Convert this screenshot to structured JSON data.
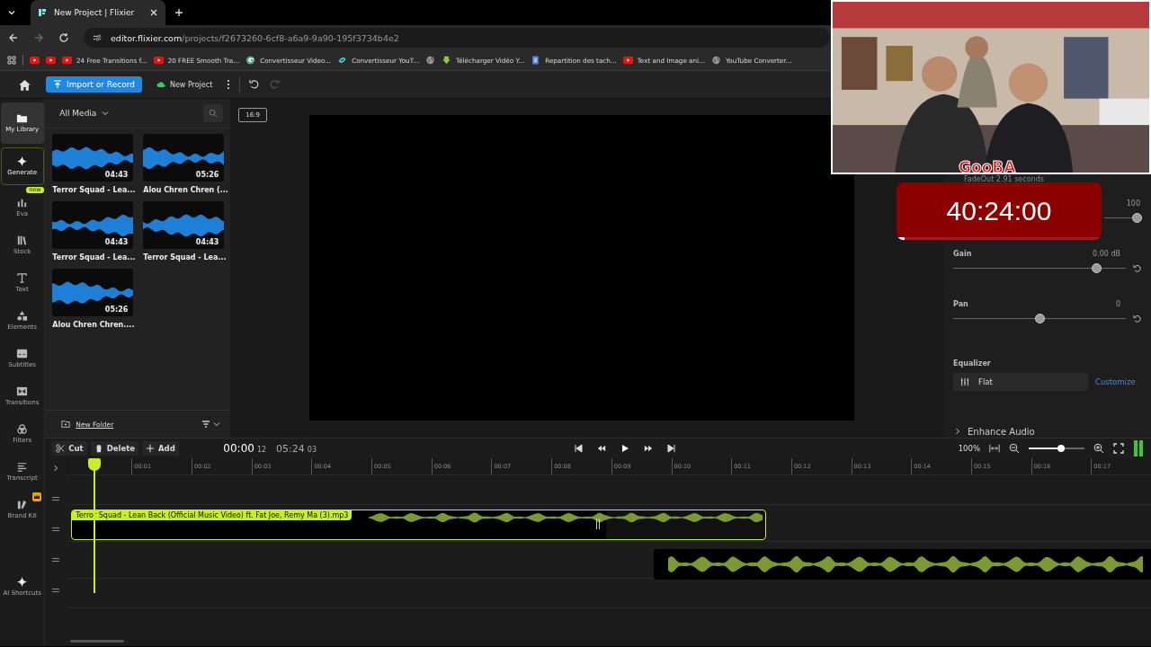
{
  "browser": {
    "tab_title": "New Project | Flixier",
    "url_host": "editor.flixier.com",
    "url_path": "/projects/f2673260-6cf8-a6a9-9a90-195f3734b4e2",
    "bookmarks": [
      {
        "kind": "youtube"
      },
      {
        "kind": "youtube"
      },
      {
        "kind": "youtube",
        "label": "24 Free Transitions f..."
      },
      {
        "kind": "youtube",
        "label": "20 FREE Smooth Tra..."
      },
      {
        "kind": "google",
        "label": "Convertisseur Video..."
      },
      {
        "kind": "converter",
        "label": "Convertisseur YouT..."
      },
      {
        "kind": "globe"
      },
      {
        "kind": "download",
        "label": "Télécharger Vidéo Y..."
      },
      {
        "kind": "docs",
        "label": "Repartition des tach..."
      },
      {
        "kind": "youtube",
        "label": "Text and Image ani..."
      },
      {
        "kind": "globe",
        "label": "YouTube Converter..."
      }
    ]
  },
  "toolbar": {
    "import_button": "Import or Record",
    "new_project": "New Project"
  },
  "nav": [
    {
      "kind": "folder",
      "label": "My Library",
      "selected": true
    },
    {
      "kind": "sparkle",
      "label": "Generate",
      "selected": false
    },
    {
      "kind": "eva",
      "label": "Eva",
      "selected": false,
      "badge": "new"
    },
    {
      "kind": "stock",
      "label": "Stock",
      "selected": false
    },
    {
      "kind": "text",
      "label": "Text",
      "selected": false
    },
    {
      "kind": "elements",
      "label": "Elements",
      "selected": false
    },
    {
      "kind": "subtitles",
      "label": "Subtitles",
      "selected": false
    },
    {
      "kind": "transitions",
      "label": "Transitions",
      "selected": false
    },
    {
      "kind": "filters",
      "label": "Filters",
      "selected": false
    },
    {
      "kind": "transcript",
      "label": "Transcript",
      "selected": false
    },
    {
      "kind": "brand",
      "label": "Brand Kit",
      "selected": false,
      "premium": true
    },
    {
      "kind": "ai",
      "label": "AI Shortcuts",
      "selected": false
    }
  ],
  "media": {
    "filter": "All Media",
    "new_folder": "New Folder",
    "items": [
      {
        "title": "Terror Squad - Lea...",
        "duration": "04:43"
      },
      {
        "title": "Alou Chren Chren (...",
        "duration": "05:26"
      },
      {
        "title": "Terror Squad - Lea...",
        "duration": "04:43"
      },
      {
        "title": "Terror Squad - Lea...",
        "duration": "04:43"
      },
      {
        "title": "Alou Chren Chren....",
        "duration": "05:26"
      }
    ]
  },
  "preview": {
    "aspect": "16:9"
  },
  "audio_panel": {
    "fade_text": "FadeOut 2.91 seconds",
    "volume": {
      "reading": "100",
      "level": 1
    },
    "gain": {
      "label": "Gain",
      "reading": "0.00 dB",
      "level": 0.85
    },
    "pan": {
      "label": "Pan",
      "reading": "0",
      "level": 0.5
    },
    "equalizer": {
      "label": "Equalizer",
      "value": "Flat",
      "action": "Customize"
    },
    "enhance": "Enhance Audio"
  },
  "overlay": {
    "streamer_tag": "GooBA",
    "timer": "40:24:00",
    "timer_bar": {
      "level": 0.04
    }
  },
  "timeline": {
    "tools": [
      {
        "kind": "scissors",
        "label": "Cut"
      },
      {
        "kind": "trash",
        "label": "Delete"
      },
      {
        "kind": "plus",
        "label": "Add"
      }
    ],
    "current_time": "00:00",
    "current_frames": "12",
    "duration": "05:24",
    "duration_frames": "03",
    "zoom": "100%",
    "zoom_slider": {
      "level": 0.6
    },
    "ruler": [
      "00:01",
      "00:02",
      "00:03",
      "00:04",
      "00:05",
      "00:06",
      "00:07",
      "00:08",
      "00:09",
      "00:10",
      "00:11",
      "00:12",
      "00:13",
      "00:14",
      "00:15",
      "00:16",
      "00:17"
    ],
    "clip_label": "Terror Squad - Lean Back (Official Music Video) ft. Fat Joe, Remy Ma (3).mp3"
  }
}
